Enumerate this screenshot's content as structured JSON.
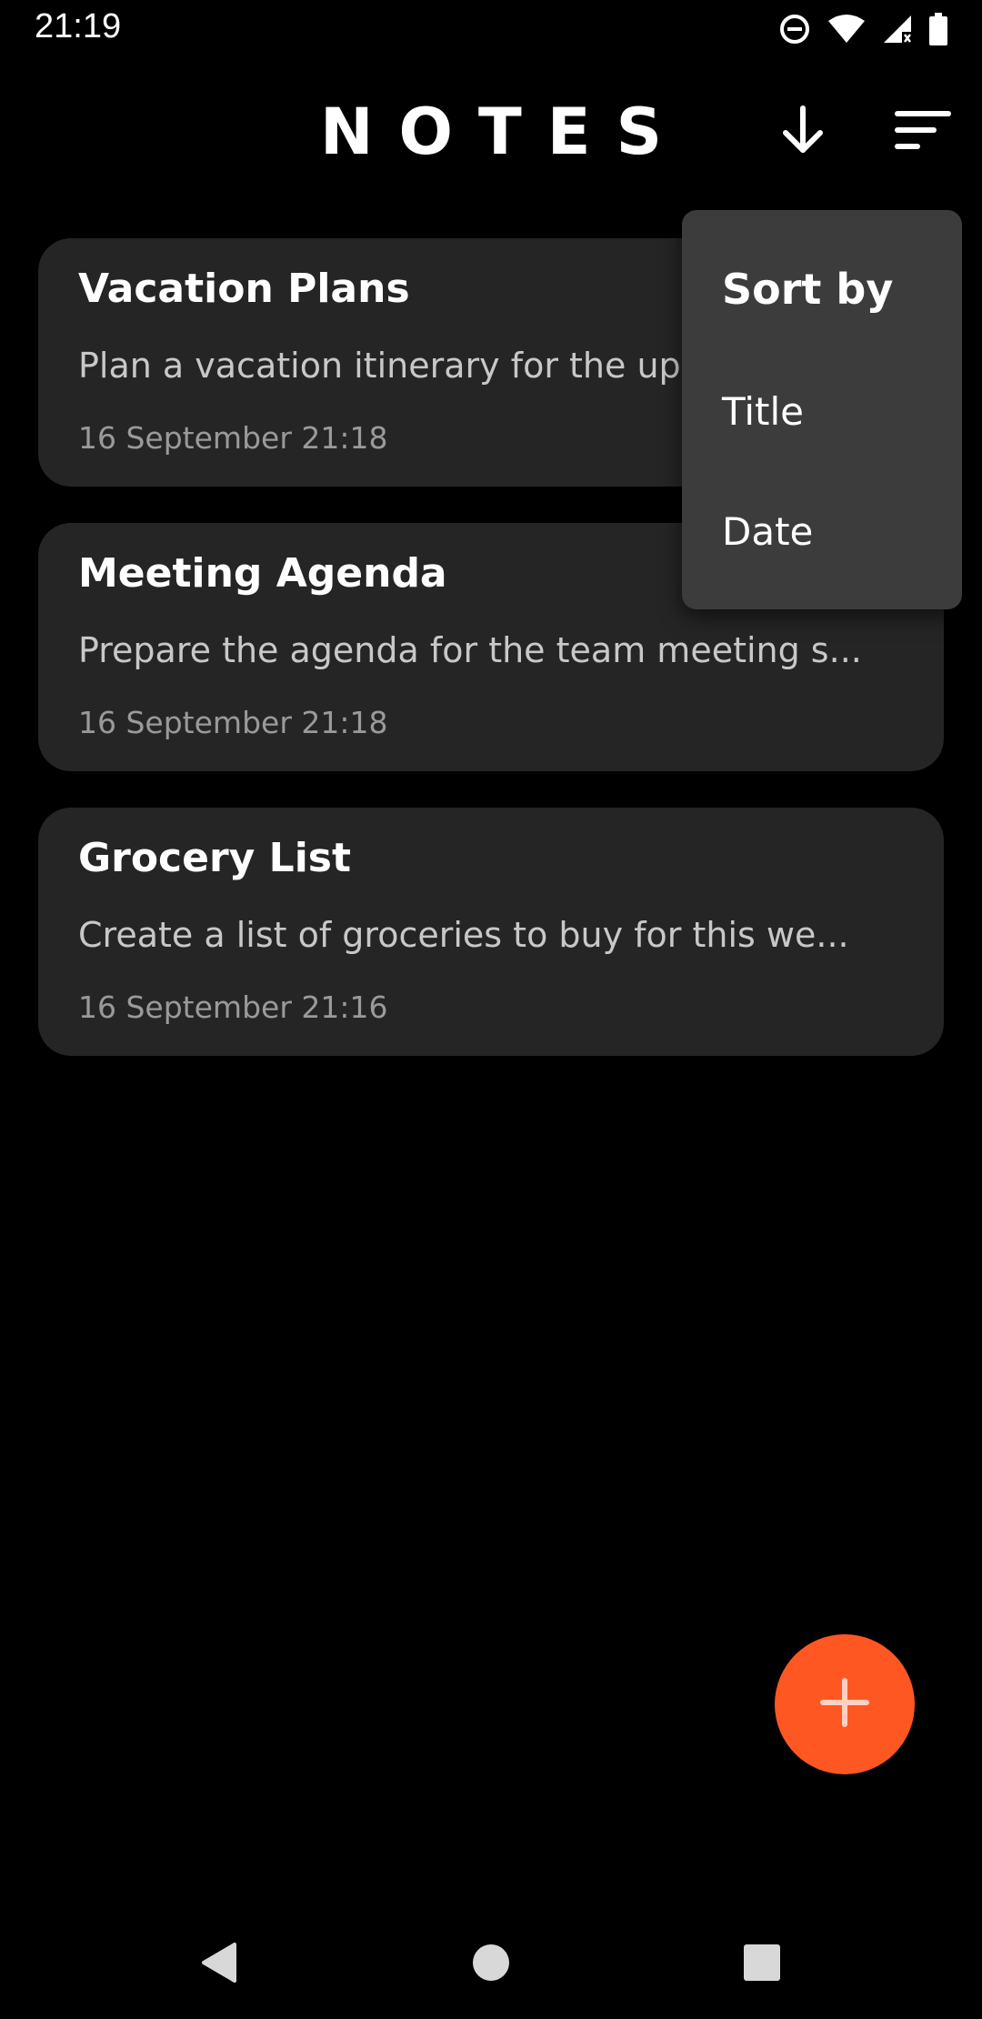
{
  "status_bar": {
    "time": "21:19",
    "icons": [
      "do-not-disturb-icon",
      "wifi-icon",
      "cell-signal-icon",
      "battery-icon"
    ]
  },
  "header": {
    "title": "NOTES",
    "sort_order_icon": "arrow-down-icon",
    "sort_menu_icon": "sort-icon"
  },
  "notes": [
    {
      "title": "Vacation Plans",
      "body": "Plan a vacation itinerary for the upcoming holidays...",
      "date": "16 September 21:18"
    },
    {
      "title": "Meeting Agenda",
      "body": "Prepare the agenda for the team meeting s...",
      "date": "16 September 21:18"
    },
    {
      "title": "Grocery List",
      "body": "Create a list of groceries to buy for this we...",
      "date": "16 September 21:16"
    }
  ],
  "sort_menu": {
    "header": "Sort by",
    "items": [
      "Title",
      "Date"
    ]
  },
  "fab": {
    "icon": "plus-icon",
    "color": "#ff5722"
  },
  "nav_bar": {
    "icons": [
      "back-icon",
      "home-icon",
      "recents-icon"
    ]
  },
  "colors": {
    "background": "#000000",
    "card": "#252525",
    "menu": "#3c3c3c",
    "accent": "#ff5722"
  }
}
